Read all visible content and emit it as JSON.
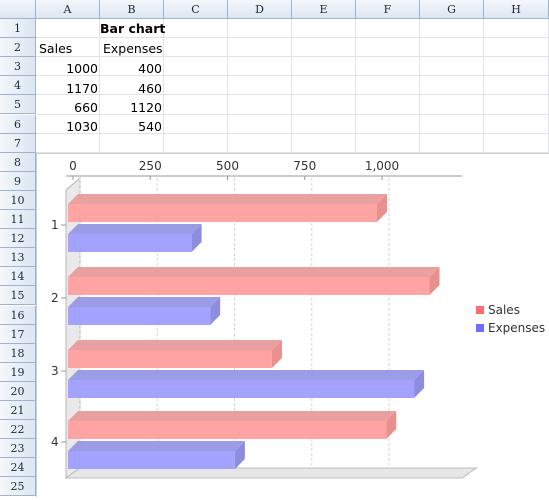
{
  "spreadsheet": {
    "columns": [
      "A",
      "B",
      "C",
      "D",
      "E",
      "F",
      "G",
      "H"
    ],
    "rows": [
      "1",
      "2",
      "3",
      "4",
      "5",
      "6",
      "7",
      "8",
      "9",
      "10",
      "11",
      "12",
      "13",
      "14",
      "15",
      "16",
      "17",
      "18",
      "19",
      "20",
      "21",
      "22",
      "23",
      "24",
      "25"
    ],
    "cells": {
      "title": "Bar chart",
      "header_sales": "Sales",
      "header_expenses": "Expenses",
      "data": [
        {
          "sales": "1000",
          "expenses": "400"
        },
        {
          "sales": "1170",
          "expenses": "460"
        },
        {
          "sales": "660",
          "expenses": "1120"
        },
        {
          "sales": "1030",
          "expenses": "540"
        }
      ]
    }
  },
  "chart_data": {
    "type": "bar",
    "orientation": "horizontal",
    "categories": [
      "1",
      "2",
      "3",
      "4"
    ],
    "series": [
      {
        "name": "Sales",
        "values": [
          1000,
          1170,
          660,
          1030
        ],
        "color": "#ff8080"
      },
      {
        "name": "Expenses",
        "values": [
          400,
          460,
          1120,
          540
        ],
        "color": "#8080ff"
      }
    ],
    "x_ticks": [
      "0",
      "250",
      "500",
      "750",
      "1,000"
    ],
    "xlim": [
      0,
      1250
    ],
    "grid": true,
    "legend": "right",
    "effect": "3d"
  }
}
